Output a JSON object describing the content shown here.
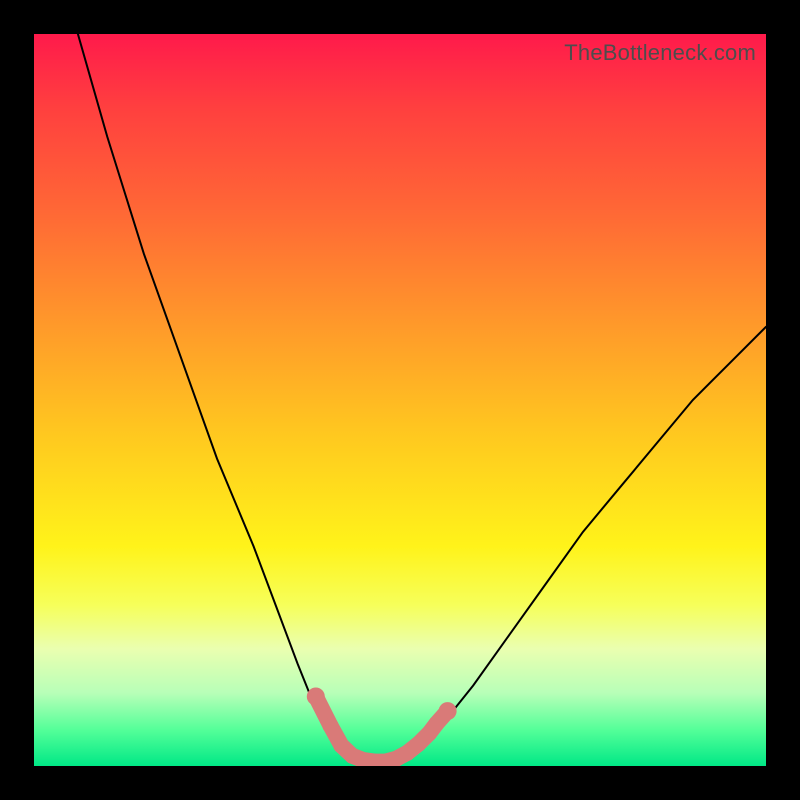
{
  "watermark": "TheBottleneck.com",
  "colors": {
    "background": "#000000",
    "gradient_top": "#ff1a4b",
    "gradient_bottom": "#00e886",
    "curve": "#000000",
    "markers": "#d97a78"
  },
  "chart_data": {
    "type": "line",
    "title": "",
    "xlabel": "",
    "ylabel": "",
    "xlim": [
      0,
      100
    ],
    "ylim": [
      0,
      100
    ],
    "grid": false,
    "legend": false,
    "axes_visible": false,
    "background_gradient": [
      "#ff1a4b",
      "#ff3f3f",
      "#ff6a35",
      "#ff9a2a",
      "#ffc91f",
      "#fff31a",
      "#f6ff5a",
      "#eaffb0",
      "#b8ffb8",
      "#55ff99",
      "#00e886"
    ],
    "series": [
      {
        "name": "bottleneck-curve",
        "x": [
          6,
          10,
          15,
          20,
          25,
          30,
          33,
          36,
          38,
          40,
          42,
          44,
          46,
          48,
          50,
          53,
          56,
          60,
          65,
          70,
          75,
          80,
          85,
          90,
          95,
          100
        ],
        "y": [
          100,
          86,
          70,
          56,
          42,
          30,
          22,
          14,
          9,
          5,
          2.5,
          1.2,
          0.6,
          0.6,
          1.2,
          3,
          6,
          11,
          18,
          25,
          32,
          38,
          44,
          50,
          55,
          60
        ]
      }
    ],
    "markers": {
      "name": "highlighted-range",
      "color": "#d97a78",
      "points": [
        {
          "x": 38.5,
          "y": 9.5
        },
        {
          "x": 40.5,
          "y": 5.5
        },
        {
          "x": 42,
          "y": 2.8
        },
        {
          "x": 43.5,
          "y": 1.4
        },
        {
          "x": 45,
          "y": 0.8
        },
        {
          "x": 46.5,
          "y": 0.6
        },
        {
          "x": 48,
          "y": 0.6
        },
        {
          "x": 49.5,
          "y": 1.0
        },
        {
          "x": 51,
          "y": 1.8
        },
        {
          "x": 52.5,
          "y": 3.0
        },
        {
          "x": 54,
          "y": 4.5
        },
        {
          "x": 55,
          "y": 5.8
        },
        {
          "x": 56.5,
          "y": 7.5
        }
      ]
    }
  }
}
